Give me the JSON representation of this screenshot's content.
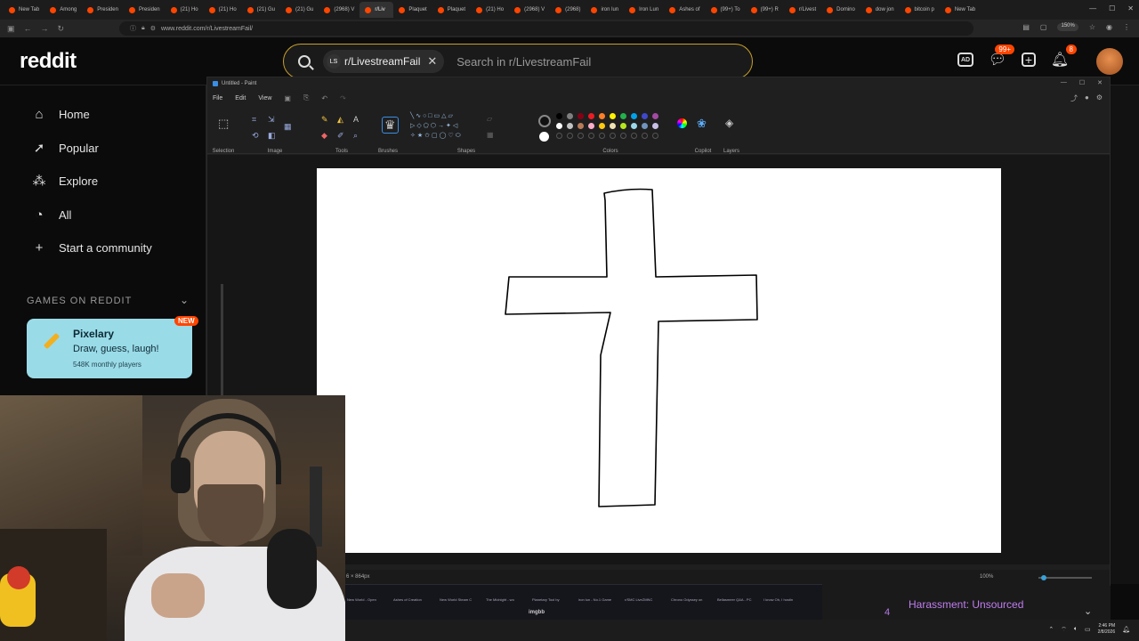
{
  "browser": {
    "tabs": [
      {
        "label": "New Tab",
        "active": false
      },
      {
        "label": "Among",
        "active": false
      },
      {
        "label": "Presiden",
        "active": false
      },
      {
        "label": "Presiden",
        "active": false
      },
      {
        "label": "(21) Ho",
        "active": false
      },
      {
        "label": "(21) Ho",
        "active": false
      },
      {
        "label": "(21) Gu",
        "active": false
      },
      {
        "label": "(21) Gu",
        "active": false
      },
      {
        "label": "(2968) V",
        "active": false
      },
      {
        "label": "r/Liv",
        "active": true
      },
      {
        "label": "Plaquet",
        "active": false
      },
      {
        "label": "Plaquet",
        "active": false
      },
      {
        "label": "(21) Ho",
        "active": false
      },
      {
        "label": "(2968) V",
        "active": false
      },
      {
        "label": "(2968)",
        "active": false
      },
      {
        "label": "iron lun",
        "active": false
      },
      {
        "label": "Iron Lun",
        "active": false
      },
      {
        "label": "Ashes of",
        "active": false
      },
      {
        "label": "(99+) To",
        "active": false
      },
      {
        "label": "(99+) R",
        "active": false
      },
      {
        "label": "r/Livest",
        "active": false
      },
      {
        "label": "Domino",
        "active": false
      },
      {
        "label": "dow jon",
        "active": false
      },
      {
        "label": "bitcoin p",
        "active": false
      },
      {
        "label": "New Tab",
        "active": false
      }
    ],
    "url": "www.reddit.com/r/LivestreamFail/",
    "zoom": "150%"
  },
  "reddit": {
    "logo": "reddit",
    "search_chip": "r/LivestreamFail",
    "search_chip_avatar": "LS",
    "search_placeholder": "Search in r/LivestreamFail",
    "chat_badge": "99+",
    "notif_badge": "8",
    "nav": [
      {
        "label": "Home",
        "icon": "home-icon"
      },
      {
        "label": "Popular",
        "icon": "popular-icon"
      },
      {
        "label": "Explore",
        "icon": "explore-icon"
      },
      {
        "label": "All",
        "icon": "all-icon"
      },
      {
        "label": "Start a community",
        "icon": "plus-icon"
      }
    ],
    "games_section": "GAMES ON REDDIT",
    "game": {
      "title": "Pixelary",
      "subtitle": "Draw, guess, laugh!",
      "players": "548K monthly players",
      "badge": "NEW"
    },
    "trend_number": "4",
    "trend_text": "Harassment: Unsourced"
  },
  "paint": {
    "title": "Untitled - Paint",
    "menu": [
      "File",
      "Edit",
      "View"
    ],
    "groups": [
      "Selection",
      "Image",
      "Tools",
      "Brushes",
      "Shapes",
      "Colors",
      "Copilot",
      "Layers"
    ],
    "palette": [
      "#000000",
      "#7f7f7f",
      "#880015",
      "#ed1c24",
      "#ff7f27",
      "#fff200",
      "#22b14c",
      "#00a2e8",
      "#3f48cc",
      "#a349a4",
      "#ffffff",
      "#c3c3c3",
      "#b97a57",
      "#ffaec9",
      "#ffc90e",
      "#efe4b0",
      "#b5e61d",
      "#99d9ea",
      "#7092be",
      "#c8bfe7"
    ],
    "canvas_size": "6 × 864px",
    "zoom": "100%"
  },
  "thumbnails": {
    "labels": [
      "New World - Open",
      "Ashes of Creation",
      "New World Steam C",
      "The Midnight - wo",
      "Planetary Tool by",
      "iron lun - No.1 Game",
      "r/SMC LiveZMNC",
      "Chrono Odyssey on",
      "Bellasmeer Q&A - PC",
      "I know Oh, I hostin"
    ],
    "label": "imgbb"
  },
  "taskbar": {
    "time": "2:46 PM",
    "date": "2/8/2026"
  }
}
